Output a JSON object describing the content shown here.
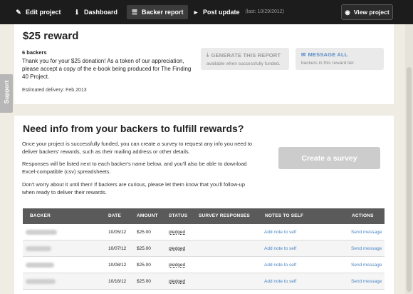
{
  "nav": {
    "items": [
      {
        "label": "Edit project",
        "icon": "pencil-icon",
        "glyph": "✎"
      },
      {
        "label": "Dashboard",
        "icon": "info-icon",
        "glyph": "ℹ"
      },
      {
        "label": "Backer report",
        "icon": "list-icon",
        "glyph": "☰",
        "active": true
      },
      {
        "label": "Post update",
        "icon": "megaphone-icon",
        "glyph": "📢"
      }
    ],
    "post_update_note": "(last: 10/29/2012)",
    "view_project": {
      "label": "View project",
      "icon": "eye-icon",
      "glyph": "👁"
    }
  },
  "support": {
    "label": "Support"
  },
  "reward": {
    "title": "$25 reward",
    "backers": "6 backers",
    "description": "Thank you for your $25 donation! As a token of our appreciation, please accept a copy of the e-book being produced for The Finding 40 Project.",
    "delivery": "Estimated delivery: Feb 2013",
    "generate": {
      "title": "GENERATE THIS REPORT",
      "sub": "available when successfully funded.",
      "icon": "download-icon",
      "glyph": "⤓"
    },
    "message": {
      "title": "MESSAGE ALL",
      "sub": "backers in this reward tier.",
      "icon": "envelope-icon",
      "glyph": "✉"
    }
  },
  "info": {
    "title": "Need info from your backers to fulfill rewards?",
    "p1": "Once your project is successfully funded, you can create a survey to request any info you need to deliver backers' rewards, such as their mailing address or other details.",
    "p2": "Responses will be listed next to each backer's name below, and you'll also be able to download Excel-compatible (csv) spreadsheets.",
    "p3": "Don't worry about it until then! If backers are curious, please let them know that you'll follow-up when ready to deliver their rewards.",
    "create_survey": "Create a survey"
  },
  "table": {
    "headers": [
      "BACKER",
      "DATE",
      "AMOUNT",
      "STATUS",
      "SURVEY RESPONSES",
      "NOTES TO SELF",
      "ACTIONS"
    ],
    "rows": [
      {
        "date": "10/05/12",
        "amount": "$25.00",
        "status": "pledged",
        "note": "Add note to self",
        "action": "Send message"
      },
      {
        "date": "10/07/12",
        "amount": "$25.00",
        "status": "pledged",
        "note": "Add note to self",
        "action": "Send message"
      },
      {
        "date": "10/08/12",
        "amount": "$25.00",
        "status": "pledged",
        "note": "Add note to self",
        "action": "Send message"
      },
      {
        "date": "10/16/12",
        "amount": "$25.00",
        "status": "pledged",
        "note": "Add note to self",
        "action": "Send message"
      }
    ]
  },
  "colors": {
    "link": "#4a86c5",
    "nav_bg": "#1c1c1c",
    "table_header": "#5a5a5a"
  }
}
